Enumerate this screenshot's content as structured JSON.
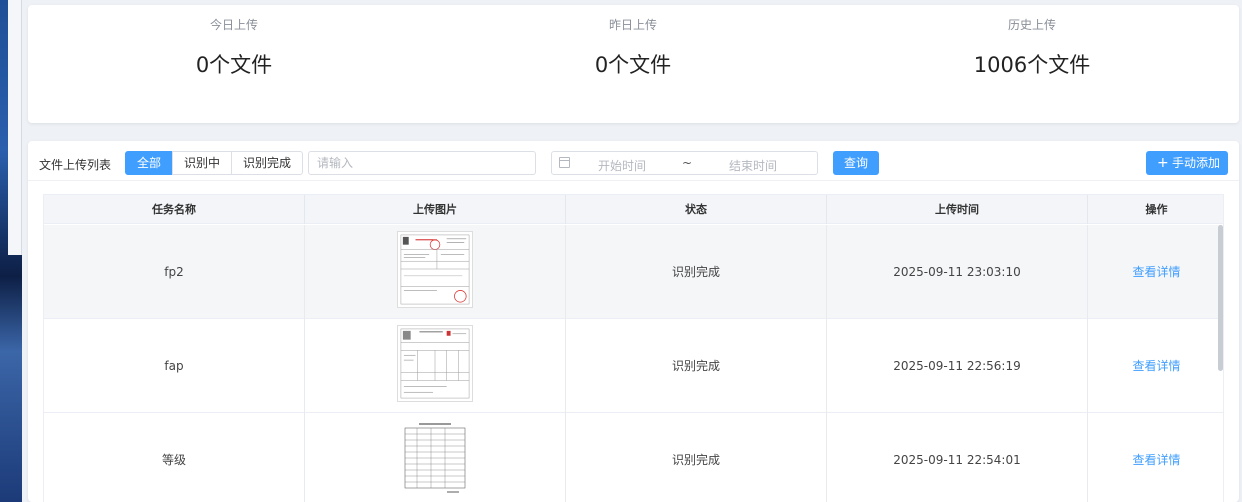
{
  "stats": [
    {
      "label": "今日上传",
      "value": "0个文件"
    },
    {
      "label": "昨日上传",
      "value": "0个文件"
    },
    {
      "label": "历史上传",
      "value": "1006个文件"
    }
  ],
  "list": {
    "title": "文件上传列表",
    "filters": [
      "全部",
      "识别中",
      "识别完成"
    ],
    "active_filter": "全部",
    "search_placeholder": "请输入",
    "date_start_placeholder": "开始时间",
    "date_separator": "~",
    "date_end_placeholder": "结束时间",
    "query_label": "查询",
    "add_label": "手动添加"
  },
  "table": {
    "columns": [
      "任务名称",
      "上传图片",
      "状态",
      "上传时间",
      "操作"
    ],
    "rows": [
      {
        "name": "fp2",
        "status": "识别完成",
        "time": "2025-09-11 23:03:10",
        "action": "查看详情"
      },
      {
        "name": "fap",
        "status": "识别完成",
        "time": "2025-09-11 22:56:19",
        "action": "查看详情"
      },
      {
        "name": "等级",
        "status": "识别完成",
        "time": "2025-09-11 22:54:01",
        "action": "查看详情"
      }
    ]
  },
  "colors": {
    "primary": "#409eff",
    "header_bg": "#f3f5f8",
    "stripe_bg": "#f5f6f8"
  }
}
